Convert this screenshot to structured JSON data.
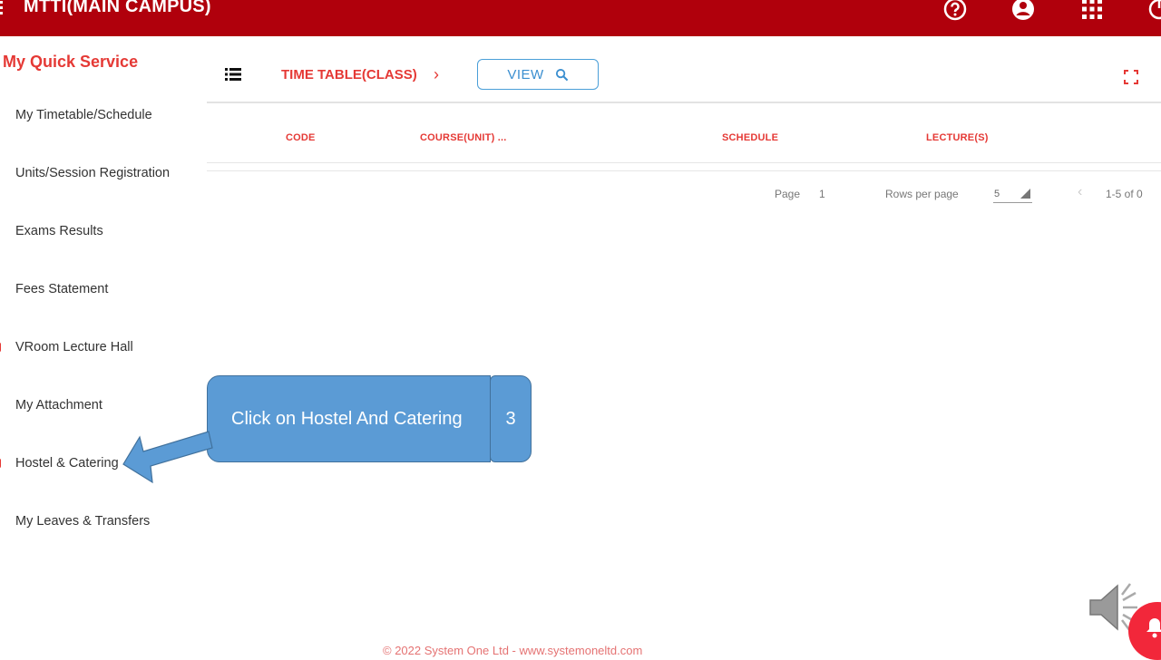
{
  "header": {
    "app_title": "MTTI(MAIN CAMPUS)",
    "icons": [
      "menu-icon",
      "help-icon",
      "account-icon",
      "apps-grid-icon",
      "power-icon"
    ]
  },
  "sidebar": {
    "title": "My Quick Service",
    "items": [
      {
        "label": "My Timetable/Schedule"
      },
      {
        "label": "Units/Session Registration"
      },
      {
        "label": "Exams Results"
      },
      {
        "label": "Fees Statement"
      },
      {
        "label": "VRoom Lecture Hall"
      },
      {
        "label": "My Attachment"
      },
      {
        "label": "Hostel & Catering"
      },
      {
        "label": "My Leaves & Transfers"
      }
    ]
  },
  "toolbar": {
    "breadcrumb": "TIME TABLE(CLASS)",
    "view_label": "VIEW"
  },
  "table": {
    "columns": [
      "CODE",
      "COURSE(UNIT) ...",
      "SCHEDULE",
      "LECTURE(S)"
    ],
    "rows": []
  },
  "pagination": {
    "page_label": "Page",
    "page_value": "1",
    "rows_per_page_label": "Rows per page",
    "rows_per_page_value": "5",
    "range": "1-5 of 0"
  },
  "callout": {
    "text": "Click on Hostel And Catering",
    "step": "3"
  },
  "footer": {
    "text": "© 2022 System One Ltd - www.systemoneltd.com"
  },
  "colors": {
    "brand": "#b0000c",
    "accent": "#e53935",
    "callout": "#5b9bd5"
  }
}
